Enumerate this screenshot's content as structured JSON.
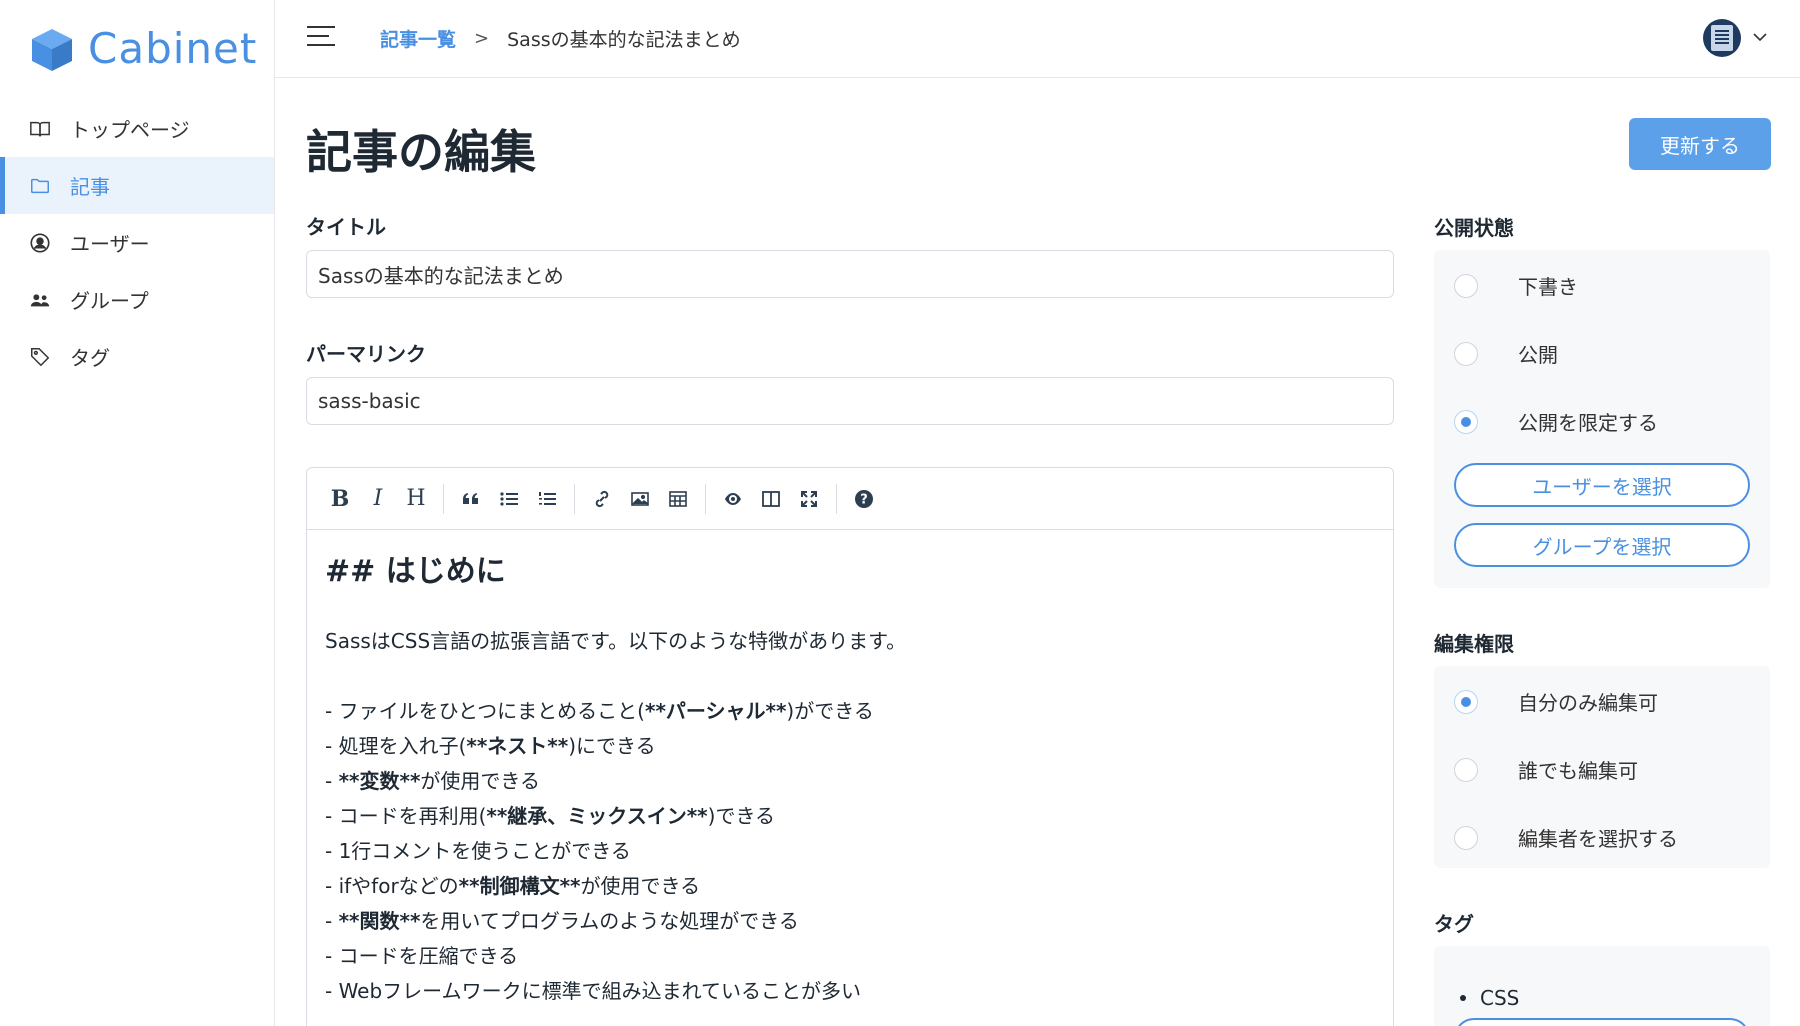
{
  "app": {
    "logo_text": "Cabinet"
  },
  "sidebar": {
    "items": [
      {
        "label": "トップページ",
        "icon": "book-icon",
        "active": false
      },
      {
        "label": "記事",
        "icon": "folder-icon",
        "active": true
      },
      {
        "label": "ユーザー",
        "icon": "user-circle-icon",
        "active": false
      },
      {
        "label": "グループ",
        "icon": "users-icon",
        "active": false
      },
      {
        "label": "タグ",
        "icon": "tag-icon",
        "active": false
      }
    ]
  },
  "header": {
    "breadcrumb": {
      "parent": "記事一覧",
      "separator": ">",
      "current": "Sassの基本的な記法まとめ"
    },
    "avatar_icon": "avatar-icon"
  },
  "main": {
    "title": "記事の編集",
    "update_button": "更新する",
    "title_field": {
      "label": "タイトル",
      "value": "Sassの基本的な記法まとめ"
    },
    "permalink_field": {
      "label": "パーマリンク",
      "value": "sass-basic"
    },
    "editor": {
      "toolbar": [
        "bold",
        "italic",
        "heading",
        "quote",
        "unordered-list",
        "ordered-list",
        "link",
        "image",
        "table",
        "preview",
        "side-by-side",
        "fullscreen",
        "help"
      ],
      "heading": "## はじめに",
      "intro": "SassはCSS言語の拡張言語です。以下のような特徴があります。",
      "lines": [
        {
          "pre": "- ファイルをひとつにまとめること(",
          "bold": "**パーシャル**",
          "post": ")ができる"
        },
        {
          "pre": "- 処理を入れ子(",
          "bold": "**ネスト**",
          "post": ")にできる"
        },
        {
          "pre": "- ",
          "bold": "**変数**",
          "post": "が使用できる"
        },
        {
          "pre": "- コードを再利用(",
          "bold": "**継承、ミックスイン**",
          "post": ")できる"
        },
        {
          "pre": "- 1行コメントを使うことができる",
          "bold": "",
          "post": ""
        },
        {
          "pre": "- ifやforなどの",
          "bold": "**制御構文**",
          "post": "が使用できる"
        },
        {
          "pre": "- ",
          "bold": "**関数**",
          "post": "を用いてプログラムのような処理ができる"
        },
        {
          "pre": "- コードを圧縮できる",
          "bold": "",
          "post": ""
        },
        {
          "pre": "- Webフレームワークに標準で組み込まれていることが多い",
          "bold": "",
          "post": ""
        }
      ]
    }
  },
  "right": {
    "publish": {
      "label": "公開状態",
      "options": [
        {
          "label": "下書き",
          "checked": false
        },
        {
          "label": "公開",
          "checked": false
        },
        {
          "label": "公開を限定する",
          "checked": true
        }
      ],
      "select_user_button": "ユーザーを選択",
      "select_group_button": "グループを選択"
    },
    "edit_permission": {
      "label": "編集権限",
      "options": [
        {
          "label": "自分のみ編集可",
          "checked": true
        },
        {
          "label": "誰でも編集可",
          "checked": false
        },
        {
          "label": "編集者を選択する",
          "checked": false
        }
      ]
    },
    "tags": {
      "label": "タグ",
      "items": [
        "CSS"
      ]
    }
  },
  "colors": {
    "accent": "#4a90e2",
    "button": "#5ba0e8",
    "active_bg": "#eaf3fc",
    "panel_bg": "#f7f8fa"
  }
}
